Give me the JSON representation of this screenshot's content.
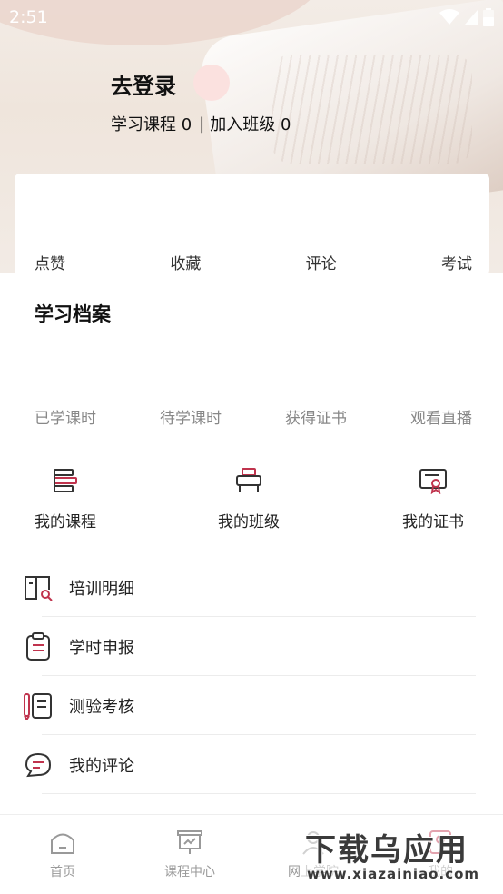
{
  "status_bar": {
    "time": "2:51"
  },
  "profile": {
    "login_label": "去登录",
    "courses_text": "学习课程 0",
    "classes_text": "加入班级 0"
  },
  "stats": [
    "点赞",
    "收藏",
    "评论",
    "考试"
  ],
  "records": {
    "title": "学习档案",
    "items": [
      "已学课时",
      "待学课时",
      "获得证书",
      "观看直播"
    ]
  },
  "quick_entries": [
    {
      "label": "我的课程",
      "icon": "course-stack-icon"
    },
    {
      "label": "我的班级",
      "icon": "classroom-desk-icon"
    },
    {
      "label": "我的证书",
      "icon": "certificate-icon"
    }
  ],
  "menu": [
    {
      "label": "培训明细",
      "icon": "book-search-icon"
    },
    {
      "label": "学时申报",
      "icon": "clipboard-icon"
    },
    {
      "label": "测验考核",
      "icon": "pencil-notebook-icon"
    },
    {
      "label": "我的评论",
      "icon": "chat-bubbles-icon"
    }
  ],
  "tabs": [
    {
      "label": "首页",
      "icon": "home-icon"
    },
    {
      "label": "课程中心",
      "icon": "presentation-board-icon"
    },
    {
      "label": "网上学院",
      "icon": "user-icon"
    },
    {
      "label": "我的",
      "icon": "profile-icon"
    }
  ],
  "watermark": {
    "text": "下载乌应用",
    "url": "www.xiazainiao.com"
  },
  "colors": {
    "accent": "#c0334d",
    "text": "#222222",
    "muted": "#888888"
  }
}
